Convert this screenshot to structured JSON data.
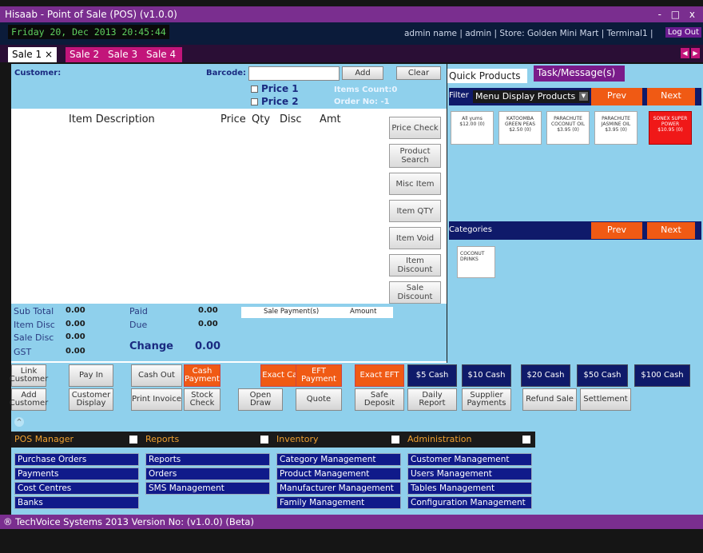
{
  "window": {
    "title": "Hisaab - Point of Sale (POS) (v1.0.0)",
    "controls": "- □ x"
  },
  "status": {
    "datetime": "Friday 20, Dec 2013 20:45:44",
    "user_info": "admin name | admin | Store: Golden Mini Mart | Terminal1 |",
    "logout": "Log Out"
  },
  "tabs": [
    {
      "label": "Sale 1 ×"
    },
    {
      "label": "Sale 2"
    },
    {
      "label": "Sale 3"
    },
    {
      "label": "Sale 4"
    }
  ],
  "tab_arrows": [
    "◀",
    "▶"
  ],
  "customer": {
    "customer_label": "Customer:",
    "barcode_label": "Barcode:",
    "barcode_value": "",
    "add": "Add",
    "clear": "Clear",
    "price1": "Price 1",
    "price2": "Price 2",
    "items_count": "Items Count:0",
    "order_no": "Order No:   -1"
  },
  "grid": {
    "cols": [
      "Item Description",
      "Price",
      "Qty",
      "Disc",
      "Amt"
    ]
  },
  "actions": [
    "Price Check",
    "Product Search",
    "Misc Item",
    "Item QTY",
    "Item Void",
    "Item Discount",
    "Sale Discount"
  ],
  "totals": {
    "sub_total_label": "Sub Total",
    "sub_total": "0.00",
    "item_disc_label": "Item Disc",
    "item_disc": "0.00",
    "sale_disc_label": "Sale Disc",
    "sale_disc": "0.00",
    "gst_label": "GST",
    "gst": "0.00",
    "paid_label": "Paid",
    "paid": "0.00",
    "due_label": "Due",
    "due": "0.00",
    "change_label": "Change",
    "change": "0.00",
    "sale_payments": "Sale Payment(s)",
    "amount": "Amount"
  },
  "right": {
    "quick_products": "Quick Products",
    "task_messages": "Task/Message(s)",
    "filter_label": "Filter",
    "filter_value": "Menu Display Products",
    "prev": "Prev",
    "next": "Next",
    "products": [
      {
        "name": "All yums",
        "price": "$12.00 (0)"
      },
      {
        "name": "KATOOMBA GREEN PEAS",
        "price": "$2.50 (0)"
      },
      {
        "name": "PARACHUTE COCONUT OIL",
        "price": "$3.95 (0)"
      },
      {
        "name": "PARACHUTE JASMINE OIL",
        "price": "$3.95 (0)"
      },
      {
        "name": "SONEX SUPER POWER",
        "price": "$10.95 (0)"
      }
    ],
    "categories_label": "Categories",
    "categories": [
      "COCONUT DRINKS"
    ]
  },
  "pay_row1": [
    "Link Customer",
    "Pay In",
    "Cash Out",
    "Cash Payment",
    "Exact Cash",
    "EFT Payment",
    "Exact EFT",
    "$5 Cash",
    "$10 Cash",
    "$20 Cash",
    "$50 Cash",
    "$100 Cash"
  ],
  "pay_row2": [
    "Add Customer",
    "Customer Display",
    "Print Invoice",
    "Stock Check",
    "Open Draw",
    "Quote",
    "Safe Deposit",
    "Daily Report",
    "Supplier Payments",
    "Refund Sale",
    "Settlement"
  ],
  "menus": {
    "pos_manager": {
      "title": "POS Manager",
      "items": [
        "Purchase Orders",
        "Payments",
        "Cost Centres",
        "Banks"
      ]
    },
    "reports": {
      "title": "Reports",
      "items": [
        "Reports",
        "Orders",
        "SMS Management"
      ]
    },
    "inventory": {
      "title": "Inventory",
      "items": [
        "Category Management",
        "Product Management",
        "Manufacturer Management",
        "Family Management"
      ]
    },
    "administration": {
      "title": "Administration",
      "items": [
        "Customer Management",
        "Users Management",
        "Tables Management",
        "Configuration Management"
      ]
    }
  },
  "footer": {
    "text": "® TechVoice Systems   2013 Version No: (v1.0.0) (Beta)"
  },
  "colors": {
    "title_purple": "#7a2e8f",
    "panel_blue": "#8fd0ec",
    "navy": "#0f1a6a",
    "orange": "#f05a14",
    "magenta": "#c2157a"
  }
}
